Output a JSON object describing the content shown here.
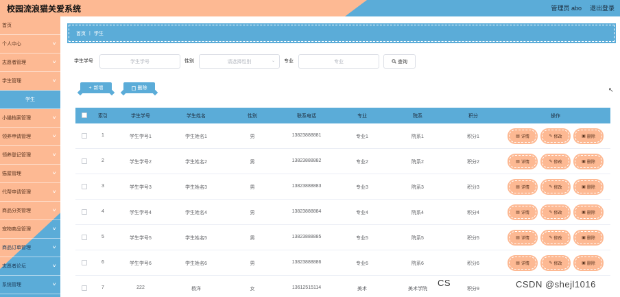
{
  "header": {
    "title": "校园流浪猫关爱系统",
    "user": "管理员 abo",
    "logout": "退出登录"
  },
  "sidebar": {
    "items": [
      {
        "label": "首页",
        "chevron": false
      },
      {
        "label": "个人中心",
        "chevron": true
      },
      {
        "label": "志愿者管理",
        "chevron": true
      },
      {
        "label": "学生管理",
        "chevron": true
      },
      {
        "label": "学生",
        "chevron": false,
        "active": true
      },
      {
        "label": "小猫档案管理",
        "chevron": true
      },
      {
        "label": "领养申请管理",
        "chevron": true
      },
      {
        "label": "领养登记管理",
        "chevron": true
      },
      {
        "label": "猫屋管理",
        "chevron": true
      },
      {
        "label": "代帮申请管理",
        "chevron": true
      },
      {
        "label": "商品分类管理",
        "chevron": true
      },
      {
        "label": "宠物商品管理",
        "chevron": true
      },
      {
        "label": "商品订单管理",
        "chevron": true
      },
      {
        "label": "志愿者论坛",
        "chevron": true
      },
      {
        "label": "系统管理",
        "chevron": true
      }
    ]
  },
  "breadcrumb": {
    "home": "首页",
    "separator": "|",
    "current": "学生"
  },
  "search": {
    "id_label": "学生学号",
    "id_placeholder": "学生学号",
    "gender_label": "性别",
    "gender_placeholder": "请选择性别",
    "major_label": "专业",
    "major_placeholder": "专业",
    "query_label": "查询"
  },
  "actions": {
    "add_label": "新增",
    "delete_label": "删除"
  },
  "table": {
    "columns": [
      "索引",
      "学生学号",
      "学生姓名",
      "性别",
      "联系电话",
      "专业",
      "院系",
      "积分",
      "操作"
    ],
    "rows": [
      {
        "index": "1",
        "id": "学生学号1",
        "name": "学生姓名1",
        "gender": "男",
        "phone": "13823888881",
        "major": "专业1",
        "dept": "院系1",
        "points": "积分1"
      },
      {
        "index": "2",
        "id": "学生学号2",
        "name": "学生姓名2",
        "gender": "男",
        "phone": "13823888882",
        "major": "专业2",
        "dept": "院系2",
        "points": "积分2"
      },
      {
        "index": "3",
        "id": "学生学号3",
        "name": "学生姓名3",
        "gender": "男",
        "phone": "13823888883",
        "major": "专业3",
        "dept": "院系3",
        "points": "积分3"
      },
      {
        "index": "4",
        "id": "学生学号4",
        "name": "学生姓名4",
        "gender": "男",
        "phone": "13823888884",
        "major": "专业4",
        "dept": "院系4",
        "points": "积分4"
      },
      {
        "index": "5",
        "id": "学生学号5",
        "name": "学生姓名5",
        "gender": "男",
        "phone": "13823888885",
        "major": "专业5",
        "dept": "院系5",
        "points": "积分5"
      },
      {
        "index": "6",
        "id": "学生学号6",
        "name": "学生姓名6",
        "gender": "男",
        "phone": "13823888886",
        "major": "专业6",
        "dept": "院系6",
        "points": "积分6"
      },
      {
        "index": "7",
        "id": "222",
        "name": "杨洋",
        "gender": "女",
        "phone": "13612515114",
        "major": "美术",
        "dept": "美术学院",
        "points": "积分9"
      }
    ],
    "op_labels": {
      "detail": "详情",
      "edit": "修改",
      "delete": "删除"
    }
  },
  "watermark": {
    "left": "CS",
    "right": "CSDN @shejl1016"
  },
  "colors": {
    "peach": "#fdb993",
    "blue": "#5bacd8"
  },
  "icons": {
    "add": "plus-icon",
    "delete": "trash-icon",
    "search": "search-icon",
    "detail": "document-icon",
    "edit": "pencil-icon",
    "chevron": "chevron-down-icon"
  }
}
